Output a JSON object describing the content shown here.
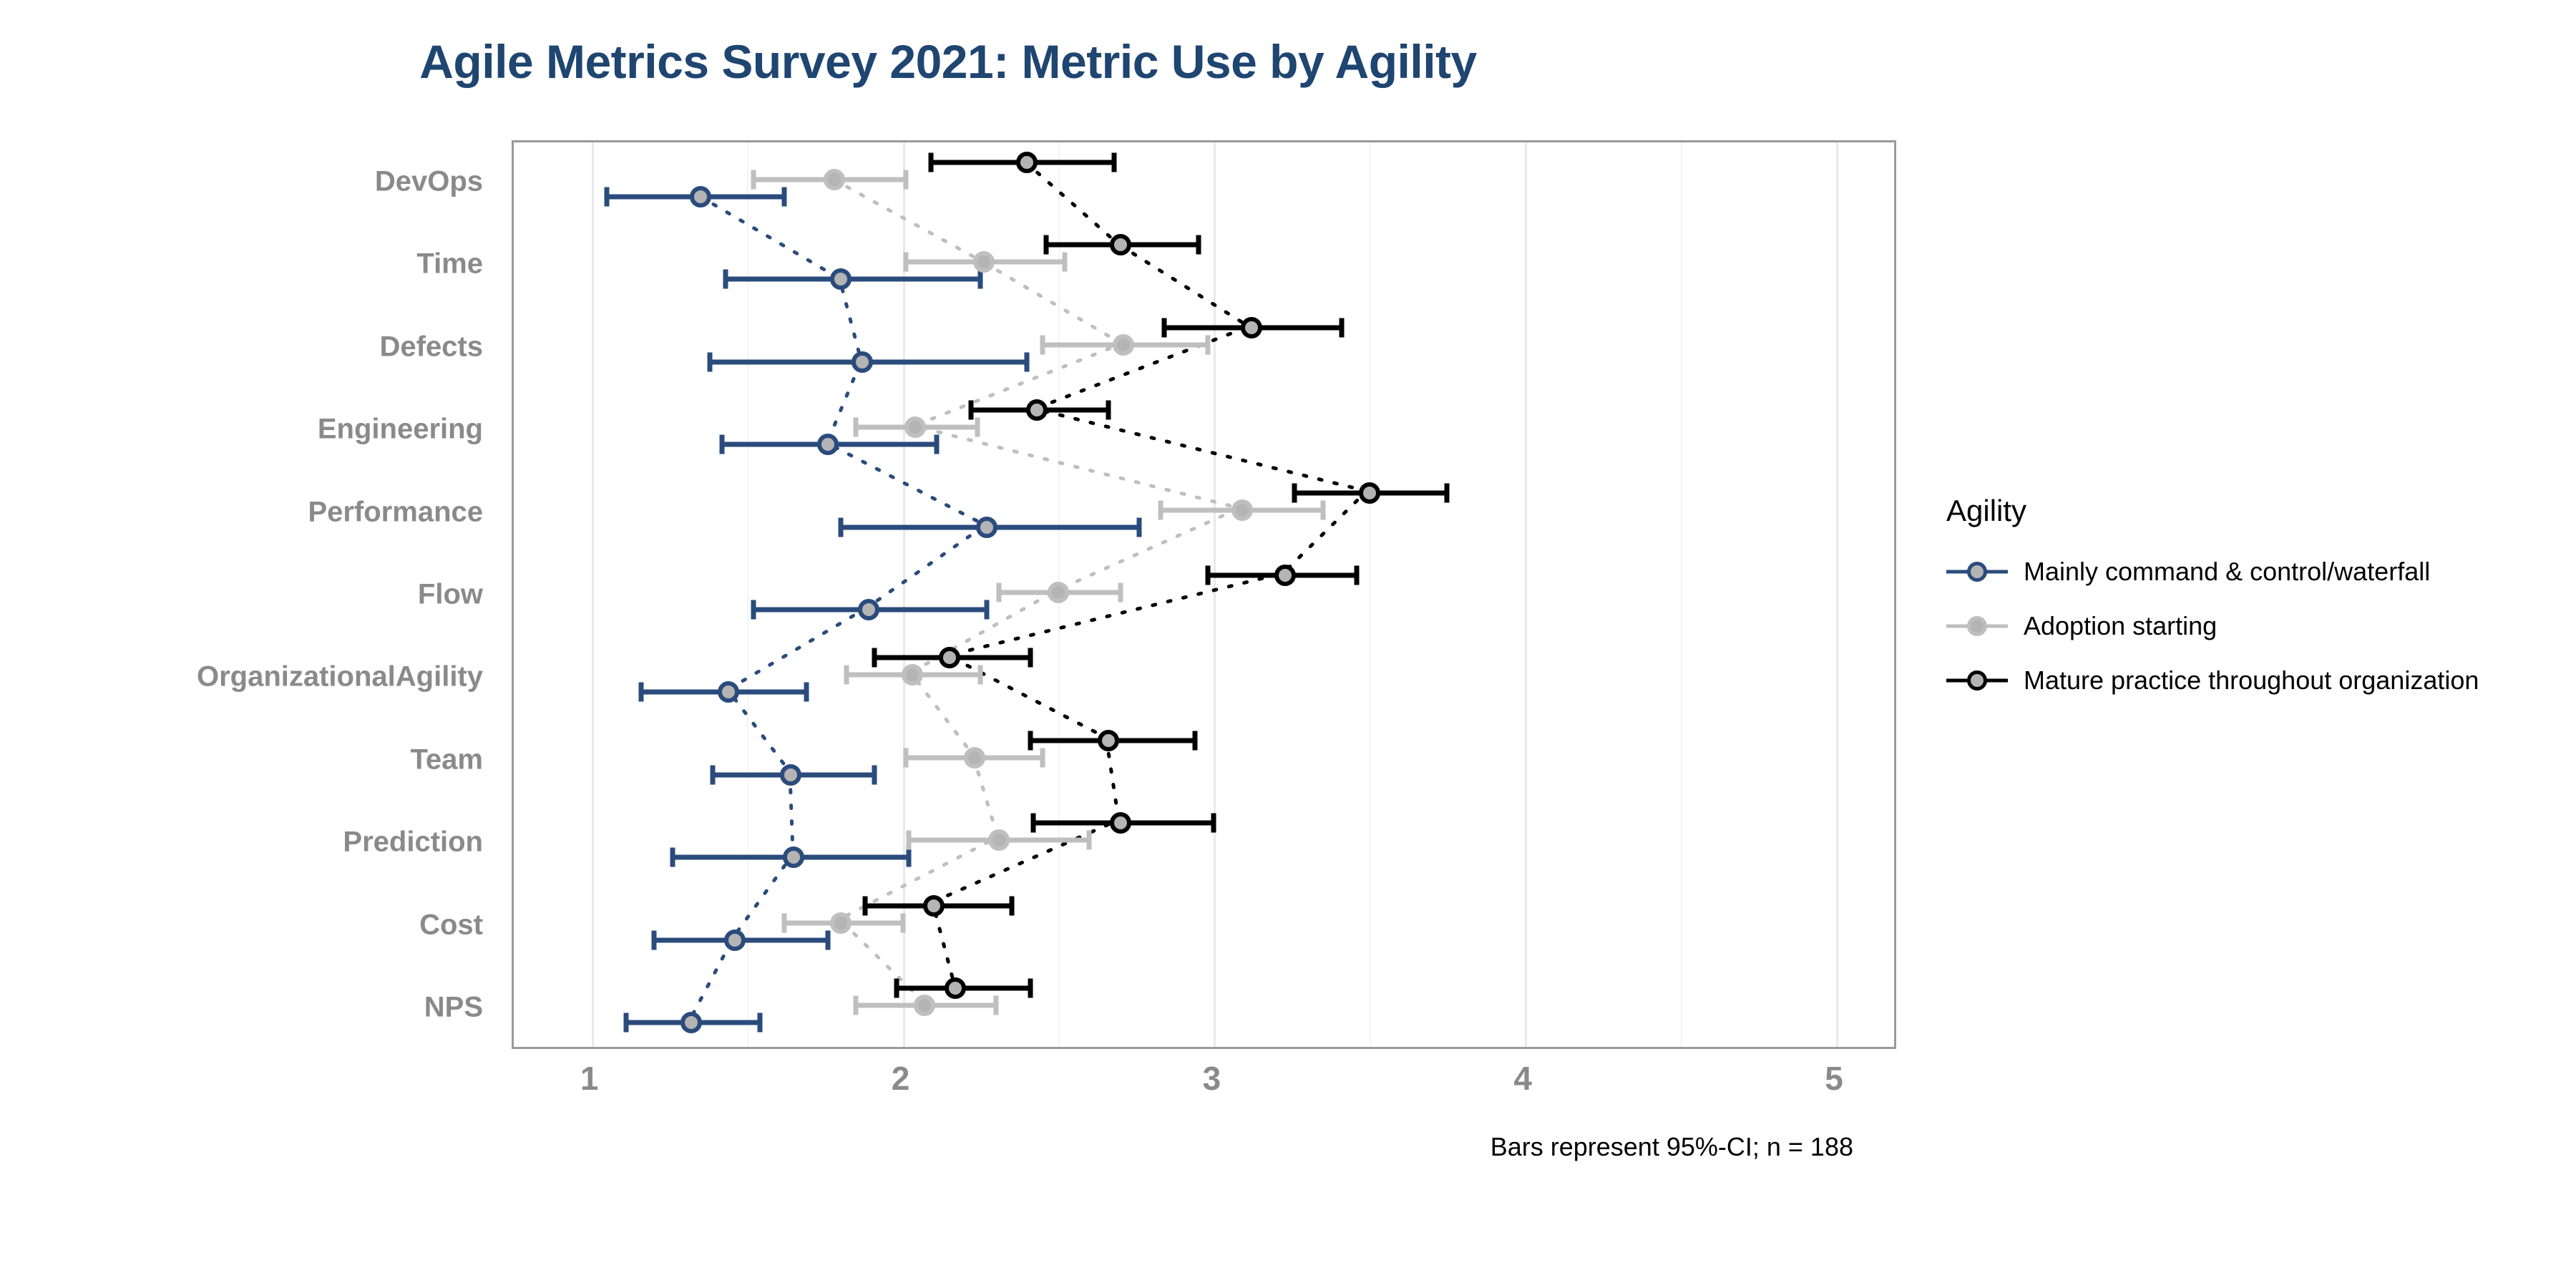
{
  "title": "Agile Metrics Survey 2021: Metric Use by Agility",
  "caption": "Bars represent 95%-CI; n = 188",
  "legend": {
    "title": "Agility",
    "items": [
      {
        "label": "Mainly command & control/waterfall",
        "color": "#2A4B7C"
      },
      {
        "label": "Adoption starting",
        "color": "#BFBFBF"
      },
      {
        "label": "Mature practice throughout organization",
        "color": "#000000"
      }
    ]
  },
  "chart_data": {
    "type": "scatter",
    "title": "Agile Metrics Survey 2021: Metric Use by Agility",
    "subtitle": "",
    "xlabel": "",
    "ylabel": "",
    "xlim": [
      0.75,
      5.2
    ],
    "xticks": [
      1,
      2,
      3,
      4,
      5
    ],
    "xtick_labels": [
      "1",
      "2",
      "3",
      "4",
      "5"
    ],
    "grid": "vertical major and minor",
    "legend_position": "right",
    "legend_title": "Agility",
    "error_bars": "95% confidence interval",
    "n": 188,
    "categories": [
      "DevOps",
      "Time",
      "Defects",
      "Engineering",
      "Performance",
      "Flow",
      "OrganizationalAgility",
      "Team",
      "Prediction",
      "Cost",
      "NPS"
    ],
    "series": [
      {
        "name": "Mainly command & control/waterfall",
        "color": "#2A4B7C",
        "values": [
          1.35,
          1.8,
          1.87,
          1.76,
          2.27,
          1.89,
          1.44,
          1.64,
          1.65,
          1.46,
          1.32
        ],
        "ci_low": [
          1.05,
          1.43,
          1.38,
          1.42,
          1.8,
          1.52,
          1.16,
          1.39,
          1.26,
          1.2,
          1.11
        ],
        "ci_high": [
          1.62,
          2.25,
          2.4,
          2.11,
          2.76,
          2.27,
          1.69,
          1.91,
          2.02,
          1.76,
          1.54
        ]
      },
      {
        "name": "Adoption starting",
        "color": "#BFBFBF",
        "values": [
          1.78,
          2.26,
          2.71,
          2.04,
          3.09,
          2.5,
          2.03,
          2.23,
          2.31,
          1.8,
          2.07
        ],
        "ci_low": [
          1.52,
          2.01,
          2.45,
          1.85,
          2.83,
          2.31,
          1.82,
          2.01,
          2.02,
          1.62,
          1.85
        ],
        "ci_high": [
          2.01,
          2.52,
          2.98,
          2.24,
          3.35,
          2.7,
          2.25,
          2.45,
          2.6,
          2.0,
          2.3
        ]
      },
      {
        "name": "Mature practice throughout organization",
        "color": "#000000",
        "values": [
          2.4,
          2.7,
          3.12,
          2.43,
          3.5,
          3.23,
          2.15,
          2.66,
          2.7,
          2.1,
          2.17
        ],
        "ci_low": [
          2.09,
          2.46,
          2.84,
          2.22,
          3.26,
          2.98,
          1.91,
          2.41,
          2.42,
          1.88,
          1.98
        ],
        "ci_high": [
          2.68,
          2.95,
          3.41,
          2.66,
          3.75,
          3.46,
          2.41,
          2.94,
          3.0,
          2.35,
          2.41
        ]
      }
    ]
  }
}
